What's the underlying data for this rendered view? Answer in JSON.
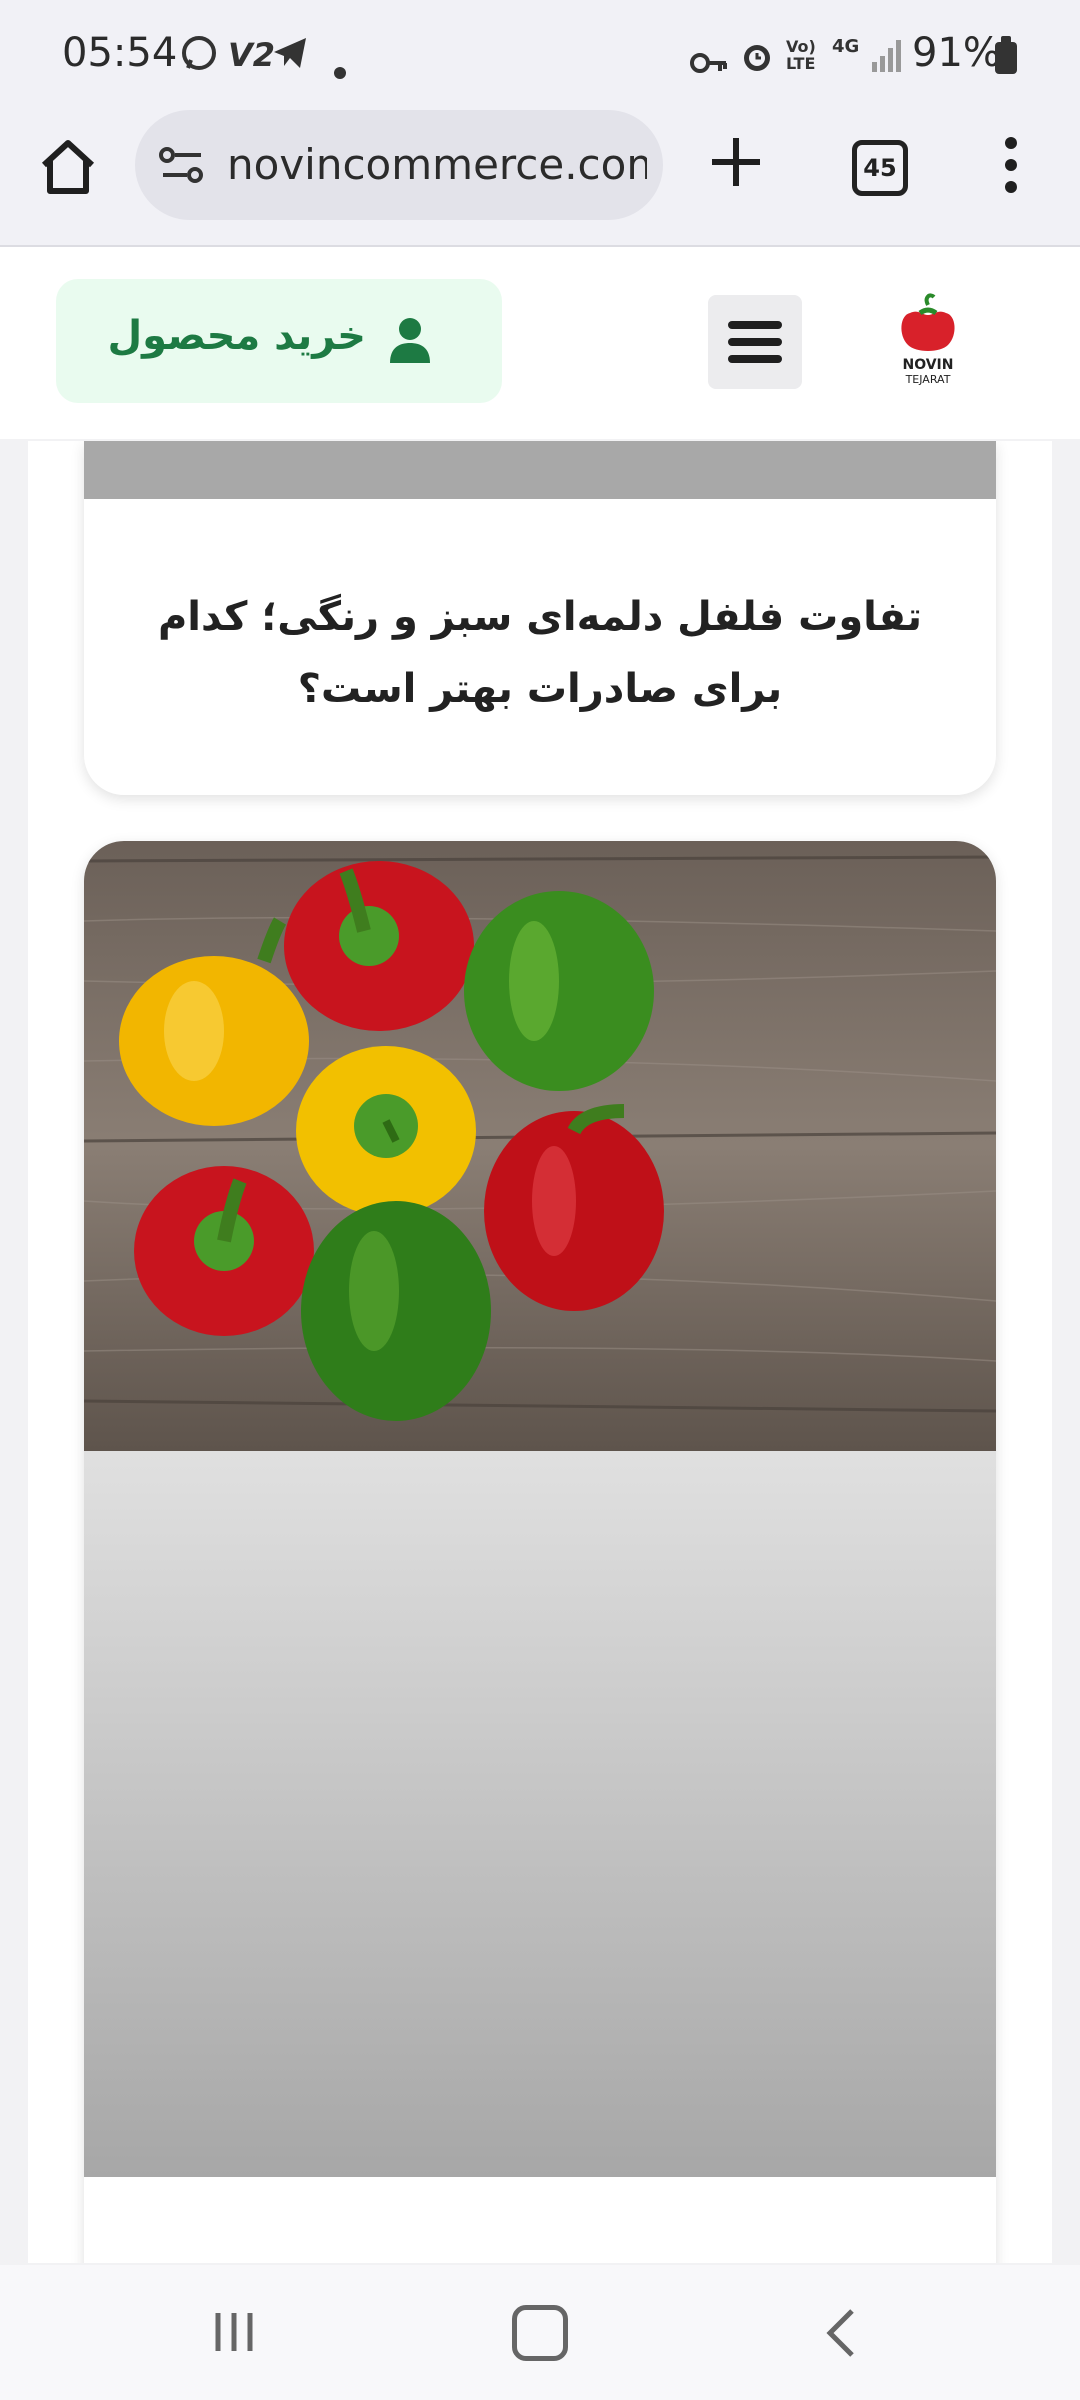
{
  "status_bar": {
    "time": "05:54",
    "battery": "91%",
    "icons": [
      "whatsapp-icon",
      "v2-icon",
      "telegram-icon",
      "dot-icon",
      "key-icon",
      "alarm-icon",
      "volte-icon",
      "4g-icon",
      "signal-icon",
      "battery-icon"
    ],
    "v2_label": "V2",
    "volte_label": "Vo) LTE",
    "net_label": "4G"
  },
  "browser": {
    "url": "novincommerce.com",
    "tab_count": "45"
  },
  "site_header": {
    "buy_button_label": "خرید محصول",
    "logo_text_top": "NOVIN",
    "logo_text_bottom": "TEJARAT"
  },
  "article_card_1": {
    "title": "تفاوت فلفل دلمه‌ای سبز و رنگی؛ کدام برای صادرات بهتر است؟"
  },
  "article_card_2": {
    "image_alt": "bell peppers on wooden table"
  },
  "colors": {
    "accent_green": "#1d7a43",
    "buy_button_bg": "#e9fbef"
  }
}
